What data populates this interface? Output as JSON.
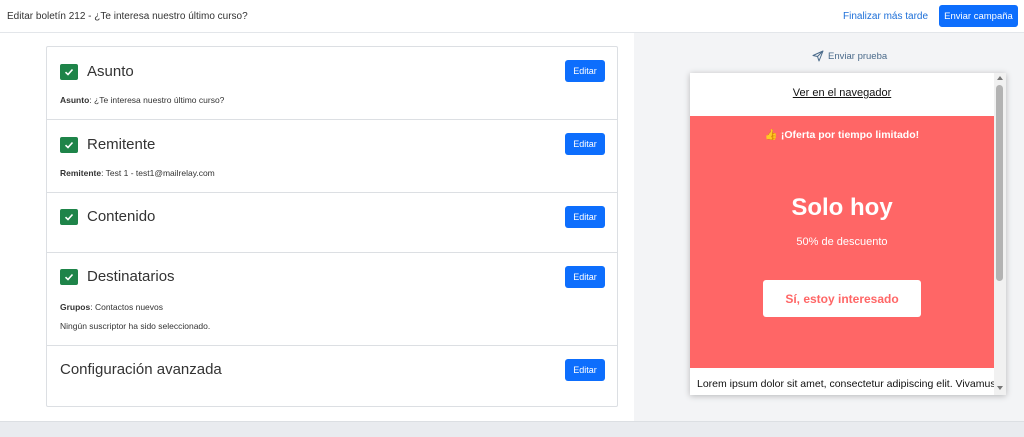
{
  "header": {
    "title": "Editar boletín 212 - ¿Te interesa nuestro último curso?",
    "finish_later_label": "Finalizar más tarde",
    "send_campaign_label": "Enviar campaña"
  },
  "sections": [
    {
      "title": "Asunto",
      "edit_label": "Editar",
      "detail_label": "Asunto",
      "detail_value": ": ¿Te interesa nuestro último curso?"
    },
    {
      "title": "Remitente",
      "edit_label": "Editar",
      "detail_label": "Remitente",
      "detail_value": ": Test 1 - test1@mailrelay.com"
    },
    {
      "title": "Contenido",
      "edit_label": "Editar"
    },
    {
      "title": "Destinatarios",
      "edit_label": "Editar",
      "detail_label": "Grupos",
      "detail_value": ": Contactos nuevos",
      "note": "Ningún suscriptor ha sido seleccionado."
    },
    {
      "title": "Configuración avanzada",
      "edit_label": "Editar"
    }
  ],
  "preview": {
    "send_test_label": "Enviar prueba",
    "browser_link": "Ver en el navegador",
    "offer": "👍 ¡Oferta por tiempo limitado!",
    "headline": "Solo hoy",
    "discount": "50% de descuento",
    "cta": "Sí, estoy interesado",
    "body_text": "Lorem ipsum dolor sit amet, consectetur adipiscing elit. Vivamus",
    "promo_color": "#ff6666"
  },
  "colors": {
    "primary": "#0d6efd",
    "check": "#1e8449"
  }
}
